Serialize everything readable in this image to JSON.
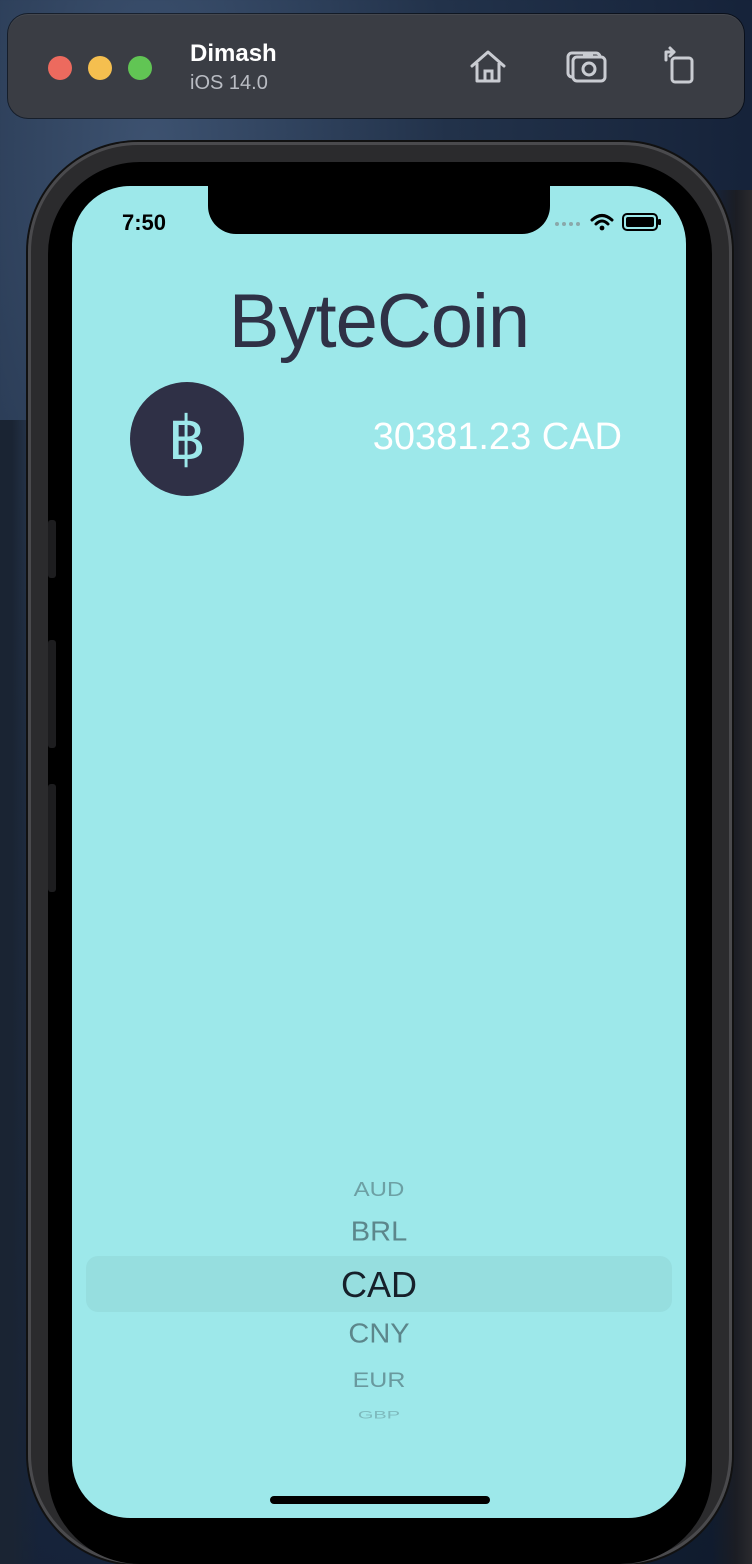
{
  "simulator": {
    "device_name": "Dimash",
    "os_version": "iOS 14.0",
    "buttons": {
      "home_icon": "home-icon",
      "screenshot_icon": "camera-icon",
      "rotate_icon": "rotate-icon"
    }
  },
  "status_bar": {
    "time": "7:50",
    "icons": [
      "signal-icon",
      "wifi-icon",
      "battery-icon"
    ]
  },
  "app": {
    "title": "ByteCoin",
    "coin_symbol": "฿",
    "rate_text": "30381.23 CAD"
  },
  "picker": {
    "items": [
      "AUD",
      "BRL",
      "CAD",
      "CNY",
      "EUR",
      "GBP"
    ],
    "selected": "CAD"
  },
  "colors": {
    "screen_background": "#9de8ea",
    "title_color": "#2f3146",
    "badge_background": "#2f3046",
    "rate_color": "#ffffff"
  }
}
